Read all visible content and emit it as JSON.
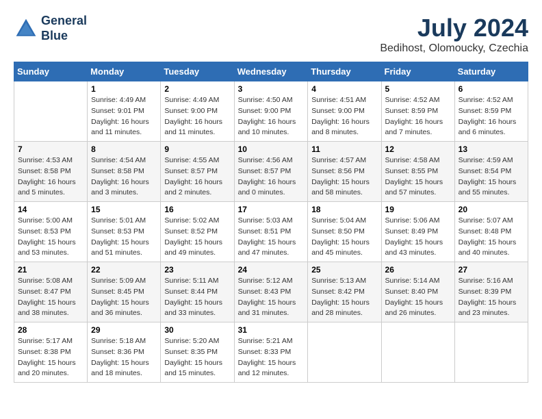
{
  "header": {
    "logo_line1": "General",
    "logo_line2": "Blue",
    "month_title": "July 2024",
    "location": "Bedihost, Olomoucky, Czechia"
  },
  "weekdays": [
    "Sunday",
    "Monday",
    "Tuesday",
    "Wednesday",
    "Thursday",
    "Friday",
    "Saturday"
  ],
  "weeks": [
    [
      {
        "day": "",
        "info": ""
      },
      {
        "day": "1",
        "info": "Sunrise: 4:49 AM\nSunset: 9:01 PM\nDaylight: 16 hours\nand 11 minutes."
      },
      {
        "day": "2",
        "info": "Sunrise: 4:49 AM\nSunset: 9:00 PM\nDaylight: 16 hours\nand 11 minutes."
      },
      {
        "day": "3",
        "info": "Sunrise: 4:50 AM\nSunset: 9:00 PM\nDaylight: 16 hours\nand 10 minutes."
      },
      {
        "day": "4",
        "info": "Sunrise: 4:51 AM\nSunset: 9:00 PM\nDaylight: 16 hours\nand 8 minutes."
      },
      {
        "day": "5",
        "info": "Sunrise: 4:52 AM\nSunset: 8:59 PM\nDaylight: 16 hours\nand 7 minutes."
      },
      {
        "day": "6",
        "info": "Sunrise: 4:52 AM\nSunset: 8:59 PM\nDaylight: 16 hours\nand 6 minutes."
      }
    ],
    [
      {
        "day": "7",
        "info": "Sunrise: 4:53 AM\nSunset: 8:58 PM\nDaylight: 16 hours\nand 5 minutes."
      },
      {
        "day": "8",
        "info": "Sunrise: 4:54 AM\nSunset: 8:58 PM\nDaylight: 16 hours\nand 3 minutes."
      },
      {
        "day": "9",
        "info": "Sunrise: 4:55 AM\nSunset: 8:57 PM\nDaylight: 16 hours\nand 2 minutes."
      },
      {
        "day": "10",
        "info": "Sunrise: 4:56 AM\nSunset: 8:57 PM\nDaylight: 16 hours\nand 0 minutes."
      },
      {
        "day": "11",
        "info": "Sunrise: 4:57 AM\nSunset: 8:56 PM\nDaylight: 15 hours\nand 58 minutes."
      },
      {
        "day": "12",
        "info": "Sunrise: 4:58 AM\nSunset: 8:55 PM\nDaylight: 15 hours\nand 57 minutes."
      },
      {
        "day": "13",
        "info": "Sunrise: 4:59 AM\nSunset: 8:54 PM\nDaylight: 15 hours\nand 55 minutes."
      }
    ],
    [
      {
        "day": "14",
        "info": "Sunrise: 5:00 AM\nSunset: 8:53 PM\nDaylight: 15 hours\nand 53 minutes."
      },
      {
        "day": "15",
        "info": "Sunrise: 5:01 AM\nSunset: 8:53 PM\nDaylight: 15 hours\nand 51 minutes."
      },
      {
        "day": "16",
        "info": "Sunrise: 5:02 AM\nSunset: 8:52 PM\nDaylight: 15 hours\nand 49 minutes."
      },
      {
        "day": "17",
        "info": "Sunrise: 5:03 AM\nSunset: 8:51 PM\nDaylight: 15 hours\nand 47 minutes."
      },
      {
        "day": "18",
        "info": "Sunrise: 5:04 AM\nSunset: 8:50 PM\nDaylight: 15 hours\nand 45 minutes."
      },
      {
        "day": "19",
        "info": "Sunrise: 5:06 AM\nSunset: 8:49 PM\nDaylight: 15 hours\nand 43 minutes."
      },
      {
        "day": "20",
        "info": "Sunrise: 5:07 AM\nSunset: 8:48 PM\nDaylight: 15 hours\nand 40 minutes."
      }
    ],
    [
      {
        "day": "21",
        "info": "Sunrise: 5:08 AM\nSunset: 8:47 PM\nDaylight: 15 hours\nand 38 minutes."
      },
      {
        "day": "22",
        "info": "Sunrise: 5:09 AM\nSunset: 8:45 PM\nDaylight: 15 hours\nand 36 minutes."
      },
      {
        "day": "23",
        "info": "Sunrise: 5:11 AM\nSunset: 8:44 PM\nDaylight: 15 hours\nand 33 minutes."
      },
      {
        "day": "24",
        "info": "Sunrise: 5:12 AM\nSunset: 8:43 PM\nDaylight: 15 hours\nand 31 minutes."
      },
      {
        "day": "25",
        "info": "Sunrise: 5:13 AM\nSunset: 8:42 PM\nDaylight: 15 hours\nand 28 minutes."
      },
      {
        "day": "26",
        "info": "Sunrise: 5:14 AM\nSunset: 8:40 PM\nDaylight: 15 hours\nand 26 minutes."
      },
      {
        "day": "27",
        "info": "Sunrise: 5:16 AM\nSunset: 8:39 PM\nDaylight: 15 hours\nand 23 minutes."
      }
    ],
    [
      {
        "day": "28",
        "info": "Sunrise: 5:17 AM\nSunset: 8:38 PM\nDaylight: 15 hours\nand 20 minutes."
      },
      {
        "day": "29",
        "info": "Sunrise: 5:18 AM\nSunset: 8:36 PM\nDaylight: 15 hours\nand 18 minutes."
      },
      {
        "day": "30",
        "info": "Sunrise: 5:20 AM\nSunset: 8:35 PM\nDaylight: 15 hours\nand 15 minutes."
      },
      {
        "day": "31",
        "info": "Sunrise: 5:21 AM\nSunset: 8:33 PM\nDaylight: 15 hours\nand 12 minutes."
      },
      {
        "day": "",
        "info": ""
      },
      {
        "day": "",
        "info": ""
      },
      {
        "day": "",
        "info": ""
      }
    ]
  ]
}
